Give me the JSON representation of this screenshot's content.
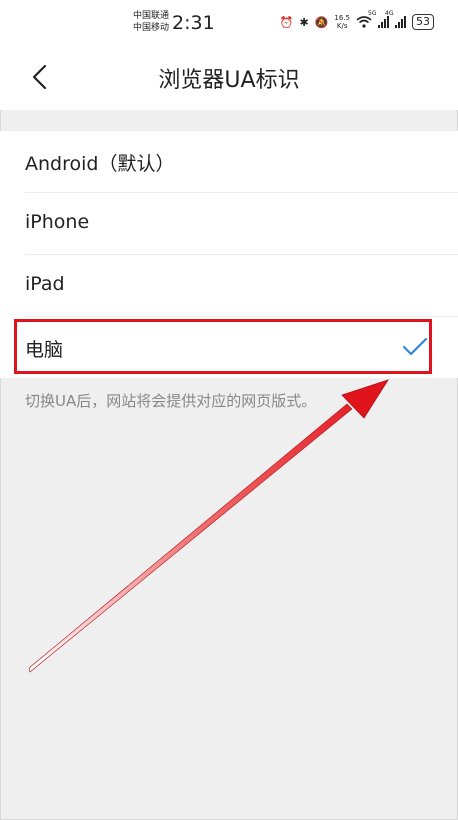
{
  "status_bar": {
    "carrier_1": "中国联通",
    "carrier_2": "中国移动",
    "time": "2:31",
    "net_speed_value": "16.5",
    "net_speed_unit": "K/s",
    "signal_1_type": "5G",
    "signal_2_type": "4G",
    "battery": "53"
  },
  "header": {
    "title": "浏览器UA标识"
  },
  "options": [
    {
      "label": "Android（默认）",
      "selected": false
    },
    {
      "label": "iPhone",
      "selected": false
    },
    {
      "label": "iPad",
      "selected": false
    },
    {
      "label": "电脑",
      "selected": true
    }
  ],
  "hint": "切换UA后，网站将会提供对应的网页版式。",
  "colors": {
    "accent": "#2f86e0",
    "annotation": "#e0141c",
    "background": "#efefef"
  }
}
